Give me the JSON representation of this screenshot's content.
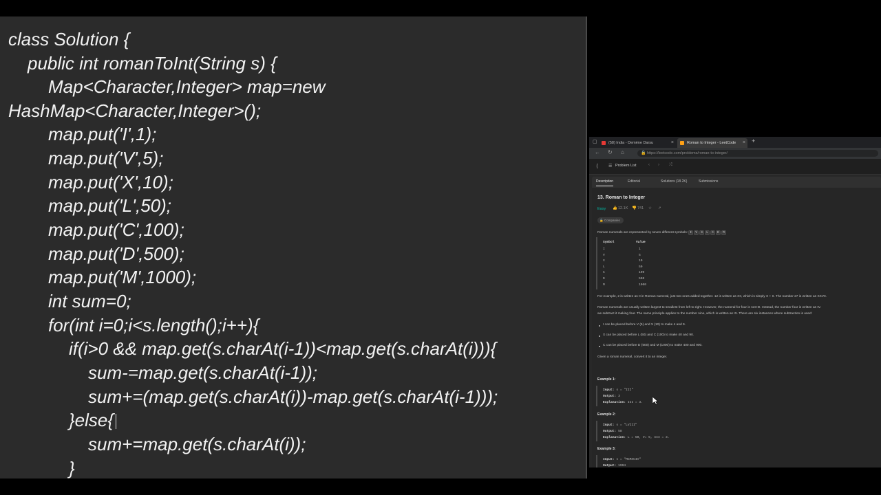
{
  "code": {
    "lines": [
      "class Solution {",
      "public int romanToInt(String s) {",
      "Map<Character,Integer> map=new",
      "HashMap<Character,Integer>();",
      "map.put('I',1);",
      "map.put('V',5);",
      "map.put('X',10);",
      "map.put('L',50);",
      "map.put('C',100);",
      "map.put('D',500);",
      "map.put('M',1000);",
      "int sum=0;",
      "for(int i=0;i<s.length();i++){",
      "if(i>0 && map.get(s.charAt(i-1))<map.get(s.charAt(i))){",
      "sum-=map.get(s.charAt(i-1));",
      "sum+=(map.get(s.charAt(i))-map.get(s.charAt(i-1)));",
      "}else{",
      "sum+=map.get(s.charAt(i));",
      "}"
    ]
  },
  "browser": {
    "tabs": [
      {
        "label": "(58) India - Demène Darsu",
        "icon_color": "#e53935"
      },
      {
        "label": "Roman to Integer - LeetCode",
        "icon_color": "#ffa116"
      }
    ],
    "url": "https://leetcode.com/problems/roman-to-integer/",
    "problem_list": "Problem List",
    "desc_tabs": [
      "Description",
      "Editorial",
      "Solutions (18.2K)",
      "Submissions"
    ],
    "problem": {
      "title": "13. Roman to Integer",
      "difficulty": "Easy",
      "likes": "12.1K",
      "dislikes": "741",
      "company_tag": "Companies",
      "intro": "Roman numerals are represented by seven different symbols:",
      "intro_symbols": [
        "I",
        "V",
        "X",
        "L",
        "C",
        "D",
        "M"
      ],
      "table_header": [
        "Symbol",
        "Value"
      ],
      "table_rows": [
        [
          "I",
          "1"
        ],
        [
          "V",
          "5"
        ],
        [
          "X",
          "10"
        ],
        [
          "L",
          "50"
        ],
        [
          "C",
          "100"
        ],
        [
          "D",
          "500"
        ],
        [
          "M",
          "1000"
        ]
      ],
      "para2": "For example, 2 is written as II in Roman numeral, just two ones added together. 12 is written as XII, which is simply X + II. The number 27 is written as XXVII.",
      "para3a": "Roman numerals are usually written largest to smallest from left to right. However, the numeral for four is not IIII. Instead, the number four is written as IV.",
      "para3b": "we subtract it making four. The same principle applies to the number nine, which is written as IX. There are six instances where subtraction is used:",
      "bullets": [
        "I can be placed before V (5) and X (10) to make 4 and 9.",
        "X can be placed before L (50) and C (100) to make 40 and 90.",
        "C can be placed before D (500) and M (1000) to make 400 and 900."
      ],
      "para4": "Given a roman numeral, convert it to an integer.",
      "examples": [
        {
          "title": "Example 1:",
          "input": "s = \"III\"",
          "output": "3",
          "explanation": "III = 3."
        },
        {
          "title": "Example 2:",
          "input": "s = \"LVIII\"",
          "output": "58",
          "explanation": "L = 50, V= 5, III = 3."
        },
        {
          "title": "Example 3:",
          "input": "s = \"MCMXCIV\"",
          "output": "1994"
        }
      ],
      "labels": {
        "input": "Input:",
        "output": "Output:",
        "explanation": "Explanation:"
      }
    }
  }
}
